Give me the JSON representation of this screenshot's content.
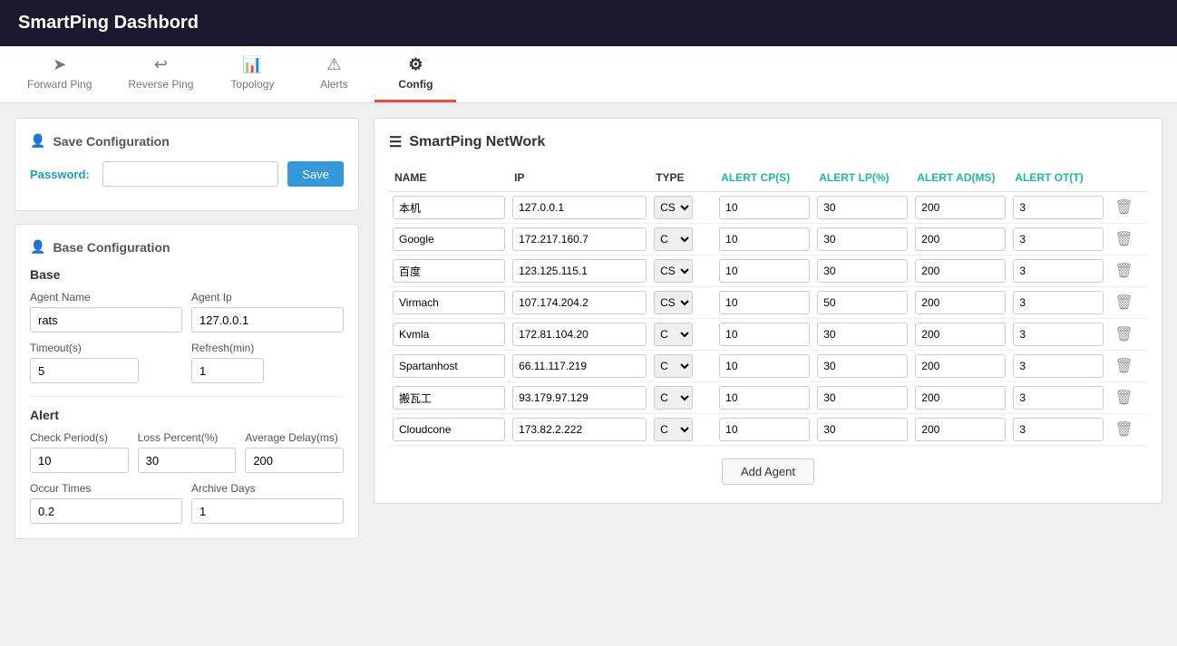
{
  "app": {
    "title": "SmartPing Dashbord"
  },
  "nav": {
    "tabs": [
      {
        "id": "forward-ping",
        "label": "Forward Ping",
        "icon": "➤",
        "active": false
      },
      {
        "id": "reverse-ping",
        "label": "Reverse Ping",
        "icon": "↩",
        "active": false
      },
      {
        "id": "topology",
        "label": "Topology",
        "icon": "📊",
        "active": false
      },
      {
        "id": "alerts",
        "label": "Alerts",
        "icon": "⚠",
        "active": false
      },
      {
        "id": "config",
        "label": "Config",
        "icon": "⚙",
        "active": true
      }
    ]
  },
  "save_config": {
    "title": "Save Configuration",
    "password_label": "Password:",
    "password_placeholder": "",
    "save_button": "Save"
  },
  "base_config": {
    "title": "Base Configuration",
    "base_section": "Base",
    "agent_name_label": "Agent Name",
    "agent_name_value": "rats",
    "agent_ip_label": "Agent Ip",
    "agent_ip_value": "127.0.0.1",
    "timeout_label": "Timeout(s)",
    "timeout_value": "5",
    "refresh_label": "Refresh(min)",
    "refresh_value": "1",
    "alert_section": "Alert",
    "check_period_label": "Check Period(s)",
    "check_period_value": "10",
    "loss_percent_label": "Loss Percent(%)",
    "loss_percent_value": "30",
    "avg_delay_label": "Average Delay(ms)",
    "avg_delay_value": "200",
    "occur_times_label": "Occur Times",
    "occur_times_value": "0.2",
    "archive_days_label": "Archive Days",
    "archive_days_value": "1"
  },
  "network": {
    "title": "SmartPing NetWork",
    "columns": {
      "name": "NAME",
      "ip": "IP",
      "type": "TYPE",
      "alert_cp": "ALERT CP(S)",
      "alert_lp": "ALERT LP(%)",
      "alert_ad": "ALERT AD(MS)",
      "alert_ot": "ALERT OT(T)"
    },
    "agents": [
      {
        "name": "本机",
        "ip": "127.0.0.1",
        "type": "CS",
        "alert_cp": "10",
        "alert_lp": "30",
        "alert_ad": "200",
        "alert_ot": "3"
      },
      {
        "name": "Google",
        "ip": "172.217.160.7",
        "type": "C",
        "alert_cp": "10",
        "alert_lp": "30",
        "alert_ad": "200",
        "alert_ot": "3"
      },
      {
        "name": "百度",
        "ip": "123.125.115.1",
        "type": "CS",
        "alert_cp": "10",
        "alert_lp": "30",
        "alert_ad": "200",
        "alert_ot": "3"
      },
      {
        "name": "Virmach",
        "ip": "107.174.204.2",
        "type": "CS",
        "alert_cp": "10",
        "alert_lp": "50",
        "alert_ad": "200",
        "alert_ot": "3"
      },
      {
        "name": "Kvmla",
        "ip": "172.81.104.20",
        "type": "C",
        "alert_cp": "10",
        "alert_lp": "30",
        "alert_ad": "200",
        "alert_ot": "3"
      },
      {
        "name": "Spartanhost",
        "ip": "66.11.117.219",
        "type": "C",
        "alert_cp": "10",
        "alert_lp": "30",
        "alert_ad": "200",
        "alert_ot": "3"
      },
      {
        "name": "搬瓦工",
        "ip": "93.179.97.129",
        "type": "C",
        "alert_cp": "10",
        "alert_lp": "30",
        "alert_ad": "200",
        "alert_ot": "3"
      },
      {
        "name": "Cloudcone",
        "ip": "173.82.2.222",
        "type": "C",
        "alert_cp": "10",
        "alert_lp": "30",
        "alert_ad": "200",
        "alert_ot": "3"
      }
    ],
    "add_agent_button": "Add Agent"
  }
}
